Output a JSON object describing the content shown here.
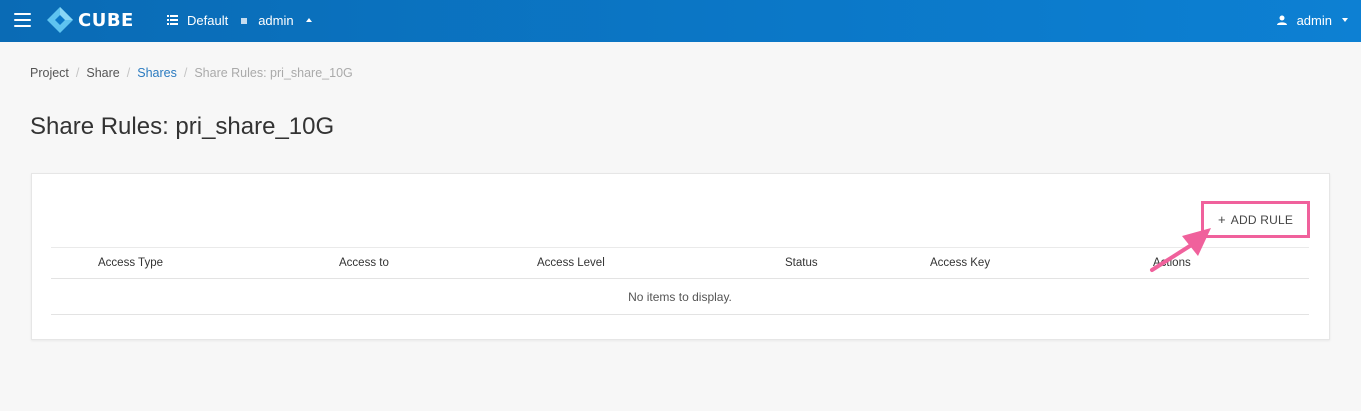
{
  "header": {
    "brand": "CUBE",
    "domain": "Default",
    "project": "admin",
    "user": "admin"
  },
  "breadcrumb": {
    "items": [
      "Project",
      "Share",
      "Shares",
      "Share Rules: pri_share_10G"
    ]
  },
  "page": {
    "title": "Share Rules: pri_share_10G"
  },
  "toolbar": {
    "add_rule_label": "ADD RULE"
  },
  "table": {
    "columns": [
      "Access Type",
      "Access to",
      "Access Level",
      "Status",
      "Access Key",
      "Actions"
    ],
    "empty_text": "No items to display."
  },
  "colors": {
    "header_bg": "#0b78c8",
    "link": "#2b7bc0",
    "highlight": "#f0619c"
  }
}
